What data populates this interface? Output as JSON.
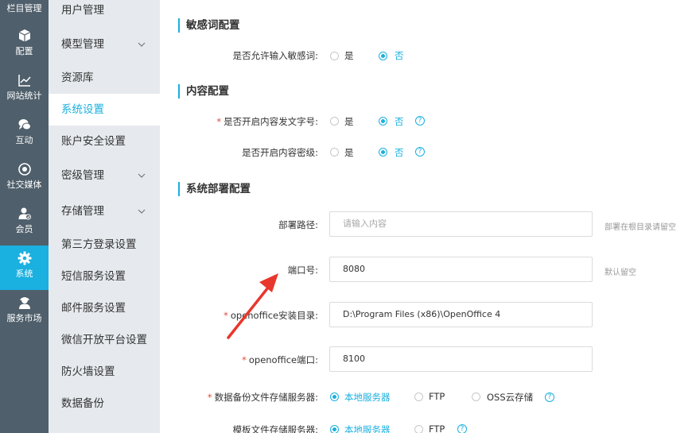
{
  "rail": {
    "top_label": "栏目管理",
    "items": [
      {
        "label": "配置",
        "icon": "cube-icon"
      },
      {
        "label": "网站统计",
        "icon": "line-chart-icon"
      },
      {
        "label": "互动",
        "icon": "chat-bubbles-icon"
      },
      {
        "label": "社交媒体",
        "icon": "target-icon"
      },
      {
        "label": "会员",
        "icon": "member-icon"
      },
      {
        "label": "系统",
        "icon": "gear-icon",
        "active": true
      },
      {
        "label": "服务市场",
        "icon": "service-user-icon"
      }
    ]
  },
  "submenu": {
    "items": [
      {
        "label": "用户管理"
      },
      {
        "label": "模型管理",
        "has_chevron": true
      },
      {
        "label": "资源库"
      },
      {
        "label": "系统设置",
        "active": true
      },
      {
        "label": "账户安全设置"
      },
      {
        "label": "密级管理",
        "has_chevron": true
      },
      {
        "label": "存储管理",
        "has_chevron": true
      },
      {
        "label": "第三方登录设置"
      },
      {
        "label": "短信服务设置"
      },
      {
        "label": "邮件服务设置"
      },
      {
        "label": "微信开放平台设置"
      },
      {
        "label": "防火墙设置"
      },
      {
        "label": "数据备份"
      }
    ]
  },
  "sections": {
    "sensitive": {
      "title": "敏感词配置",
      "allow_label": "是否允许输入敏感词:",
      "yes": "是",
      "no": "否",
      "selected": "否"
    },
    "content": {
      "title": "内容配置",
      "doc_number_label": "是否开启内容发文字号:",
      "doc_number_required": "*",
      "secret_level_label": "是否开启内容密级:",
      "yes": "是",
      "no": "否",
      "selected_doc_number": "否",
      "selected_secret_level": "否",
      "help_glyph": "?"
    },
    "deploy": {
      "title": "系统部署配置",
      "path_label": "部署路径:",
      "path_placeholder": "请输入内容",
      "path_hint": "部署在根目录请留空",
      "port_label": "端口号:",
      "port_value": "8080",
      "port_hint": "默认留空",
      "office_dir_label": "openoffice安装目录:",
      "office_dir_value": "D:\\Program Files (x86)\\OpenOffice 4",
      "office_port_label": "openoffice端口:",
      "office_port_value": "8100",
      "backup_storage_label": "数据备份文件存储服务器:",
      "template_storage_label": "模板文件存储服务器:",
      "required_mark": "*",
      "storage_options": [
        "本地服务器",
        "FTP",
        "OSS云存储"
      ],
      "selected_backup_storage": "本地服务器",
      "selected_template_storage": "本地服务器",
      "help_glyph": "?"
    }
  },
  "colors": {
    "accent": "#1ab0e0",
    "rail_bg": "#4f5f6b",
    "submenu_bg": "#e6eaee",
    "required": "#e04b3a",
    "annotation_arrow": "#e8372c"
  }
}
